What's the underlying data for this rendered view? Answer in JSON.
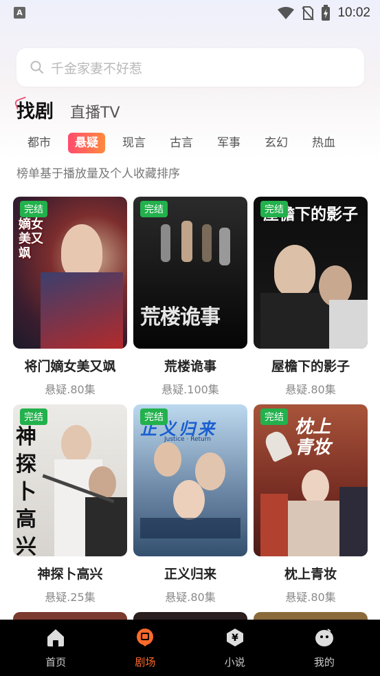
{
  "status": {
    "time": "10:02",
    "left_icon": "A"
  },
  "search": {
    "placeholder": "千金家妻不好惹"
  },
  "top_tabs": [
    {
      "label": "找剧",
      "active": true
    },
    {
      "label": "直播TV",
      "active": false
    }
  ],
  "categories": [
    {
      "label": "都市",
      "active": false
    },
    {
      "label": "悬疑",
      "active": true
    },
    {
      "label": "现言",
      "active": false
    },
    {
      "label": "古言",
      "active": false
    },
    {
      "label": "军事",
      "active": false
    },
    {
      "label": "玄幻",
      "active": false
    },
    {
      "label": "热血",
      "active": false
    }
  ],
  "rank_note": "榜单基于播放量及个人收藏排序",
  "dramas": [
    {
      "title": "将门嫡女美又飒",
      "meta": "悬疑.80集",
      "badge": "完结",
      "poster_text": "嫡女美又飒"
    },
    {
      "title": "荒楼诡事",
      "meta": "悬疑.100集",
      "badge": "完结",
      "poster_text": "荒楼诡事"
    },
    {
      "title": "屋檐下的影子",
      "meta": "悬疑.80集",
      "badge": "完结",
      "poster_text": "屋檐下的影子"
    },
    {
      "title": "神探卜高兴",
      "meta": "悬疑.25集",
      "badge": "完结",
      "poster_text": "神探卜高兴"
    },
    {
      "title": "正义归来",
      "meta": "悬疑.80集",
      "badge": "完结",
      "poster_text": "正义归来",
      "poster_subtext": "Justice · Return"
    },
    {
      "title": "枕上青妆",
      "meta": "悬疑.80集",
      "badge": "完结",
      "poster_text": "枕上青妆"
    }
  ],
  "bottom_nav": [
    {
      "label": "首页",
      "icon": "home-icon",
      "active": false
    },
    {
      "label": "剧场",
      "icon": "theater-icon",
      "active": true
    },
    {
      "label": "小说",
      "icon": "novel-icon",
      "active": false
    },
    {
      "label": "我的",
      "icon": "profile-icon",
      "active": false
    }
  ],
  "colors": {
    "accent_start": "#ff4b6e",
    "accent_end": "#ff8a3d",
    "badge_green": "#22b14c",
    "nav_active": "#ff6a2a"
  }
}
